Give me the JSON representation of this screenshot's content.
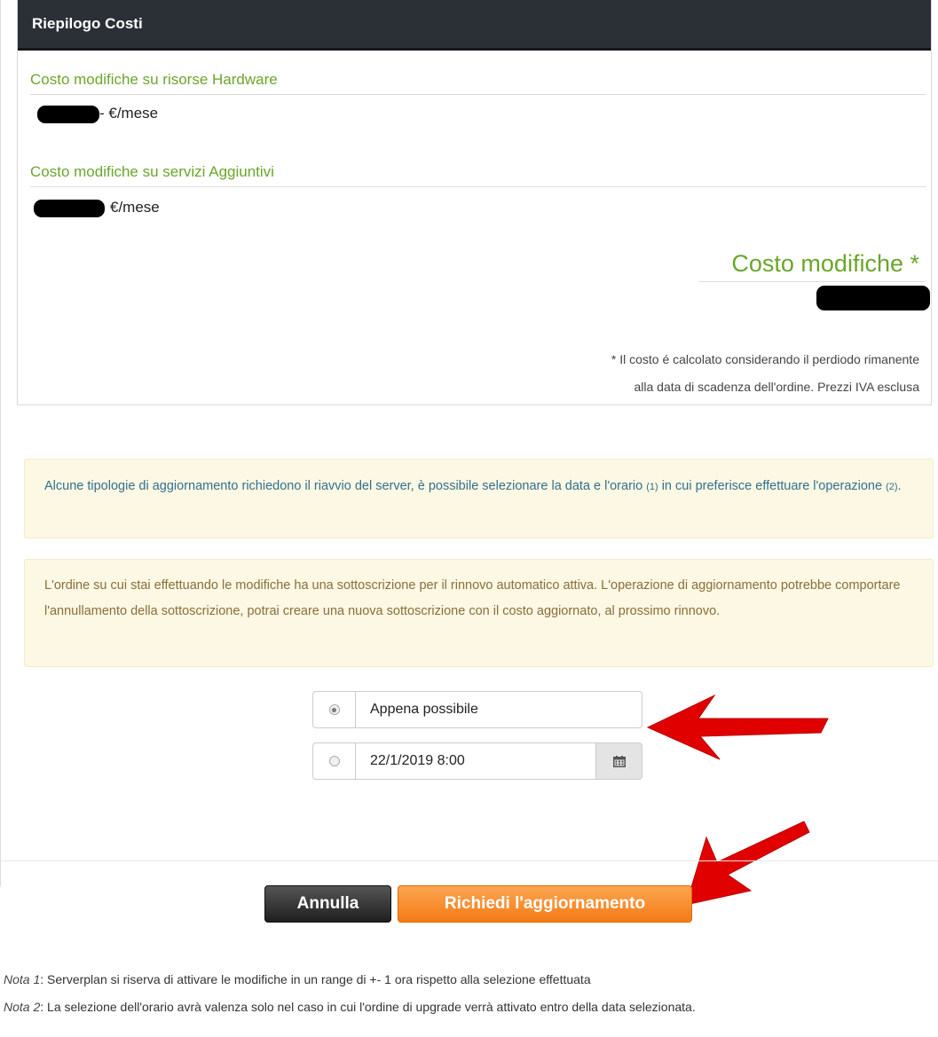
{
  "panel": {
    "title": "Riepilogo Costi",
    "hardware": {
      "title": "Costo modifiche su risorse Hardware",
      "suffix": "- €/mese"
    },
    "services": {
      "title": "Costo modifiche su servizi Aggiuntivi",
      "suffix": "€/mese"
    },
    "total_title": "Costo modifiche *",
    "footnote_line1": "* Il costo é calcolato considerando il perdiodo rimanente",
    "footnote_line2": "alla data di scadenza dell'ordine. Prezzi IVA esclusa"
  },
  "alerts": {
    "info_part1": "Alcune tipologie di aggiornamento richiedono il riavvio del server, è possibile selezionare la data e l'orario",
    "info_ref1": "(1)",
    "info_part2": "in cui preferisce effettuare l'operazione",
    "info_ref2": "(2)",
    "info_end": ".",
    "warning": "L'ordine su cui stai effettuando le modifiche ha una sottoscrizione per il rinnovo automatico attiva. L'operazione di aggiornamento potrebbe comportare l'annullamento della sottoscrizione, potrai creare una nuova sottoscrizione con il costo aggiornato, al prossimo rinnovo."
  },
  "schedule": {
    "option_asap": "Appena possibile",
    "option_date_value": "22/1/2019 8:00",
    "selected": "asap",
    "calendar_icon": "calendar-icon"
  },
  "buttons": {
    "cancel": "Annulla",
    "submit": "Richiedi l'aggiornamento"
  },
  "notes": [
    {
      "label": "Nota 1",
      "text": ": Serverplan si riserva di attivare le modifiche in un range di +- 1 ora rispetto alla selezione effettuata"
    },
    {
      "label": "Nota 2",
      "text": ": La selezione dell'orario avrà valenza solo nel caso in cui l'ordine di upgrade verrà attivato entro della data selezionata."
    }
  ],
  "colors": {
    "green": "#6aa62b",
    "header_bg": "#2b2f36",
    "orange": "#f57a14",
    "annotation_arrow": "#e10000"
  }
}
